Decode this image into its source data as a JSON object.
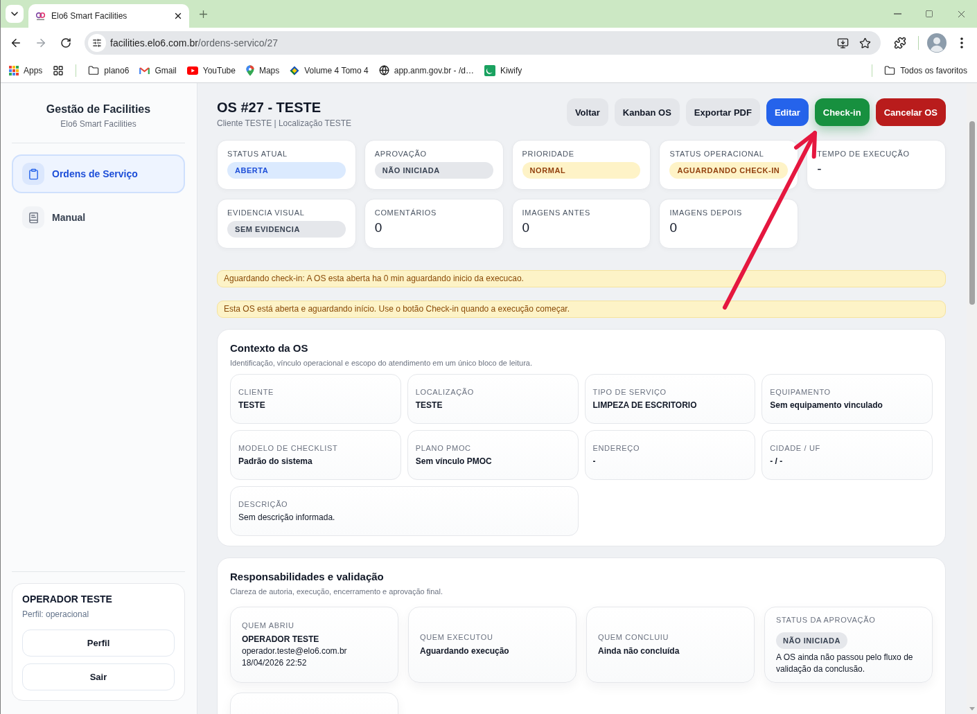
{
  "browser": {
    "tab_title": "Elo6 Smart Facilities",
    "url": {
      "host": "facilities.elo6.com.br",
      "path": "/ordens-servico/27"
    },
    "bookmarks": [
      {
        "kind": "apps",
        "label": "Apps"
      },
      {
        "kind": "groups"
      },
      {
        "kind": "folder",
        "label": "plano6"
      },
      {
        "kind": "mail",
        "label": "Gmail"
      },
      {
        "kind": "video",
        "label": "YouTube"
      },
      {
        "kind": "map",
        "label": "Maps"
      },
      {
        "kind": "site",
        "label": "Volume 4 Tomo 4"
      },
      {
        "kind": "globe",
        "label": "app.anm.gov.br - /d…"
      },
      {
        "kind": "tile",
        "label": "Kiwify"
      }
    ],
    "all_bookmarks": "Todos os favoritos"
  },
  "sidebar": {
    "title": "Gestão de Facilities",
    "subtitle": "Elo6 Smart Facilities",
    "nav": [
      {
        "kind": "orders",
        "label": "Ordens de Serviço",
        "selected": true
      },
      {
        "kind": "manual",
        "label": "Manual",
        "selected": false
      }
    ],
    "user": {
      "name": "OPERADOR TESTE",
      "role": "Perfil: operacional",
      "buttons": [
        "Perfil",
        "Sair"
      ]
    }
  },
  "header": {
    "title": "OS #27 - TESTE",
    "subtitle": "Cliente TESTE | Localização TESTE",
    "actions": [
      {
        "kind": "neutral",
        "label": "Voltar"
      },
      {
        "kind": "neutral",
        "label": "Kanban OS"
      },
      {
        "kind": "neutral",
        "label": "Exportar PDF"
      },
      {
        "kind": "primary",
        "label": "Editar"
      },
      {
        "kind": "success",
        "label": "Check-in"
      },
      {
        "kind": "danger",
        "label": "Cancelar OS"
      }
    ]
  },
  "summary_cards": [
    {
      "kind": "pill",
      "label": "STATUS ATUAL",
      "value": "ABERTA",
      "color": "#dbeafe"
    },
    {
      "kind": "pill",
      "label": "APROVAÇÃO",
      "value": "NÃO INICIADA",
      "color": "#e5e7eb"
    },
    {
      "kind": "pill",
      "label": "PRIORIDADE",
      "value": "NORMAL",
      "color": "#fef3c7"
    },
    {
      "kind": "pill",
      "label": "STATUS OPERACIONAL",
      "value": "AGUARDANDO CHECK-IN",
      "color": "#fef3c7"
    },
    {
      "kind": "count",
      "label": "TEMPO DE EXECUÇÃO",
      "value": "-"
    },
    {
      "kind": "pill",
      "label": "EVIDENCIA VISUAL",
      "value": "SEM EVIDENCIA",
      "color": "#e5e7eb"
    },
    {
      "kind": "count",
      "label": "COMENTÁRIOS",
      "value": "0"
    },
    {
      "kind": "count",
      "label": "IMAGENS ANTES",
      "value": "0"
    },
    {
      "kind": "count",
      "label": "IMAGENS DEPOIS",
      "value": "0"
    }
  ],
  "alerts": [
    "Aguardando check-in: A OS esta aberta ha 0 min aguardando inicio da execucao.",
    "Esta OS está aberta e aguardando início. Use o botão Check-in quando a execução começar."
  ],
  "context": {
    "title": "Contexto da OS",
    "subtitle": "Identificação, vínculo operacional e escopo do atendimento em um único bloco de leitura.",
    "fields": [
      {
        "kind": "field",
        "label": "CLIENTE",
        "value": "TESTE"
      },
      {
        "kind": "field",
        "label": "LOCALIZAÇÃO",
        "value": "TESTE"
      },
      {
        "kind": "field",
        "label": "TIPO DE SERVIÇO",
        "value": "LIMPEZA DE ESCRITORIO"
      },
      {
        "kind": "field",
        "label": "EQUIPAMENTO",
        "value": "Sem equipamento vinculado"
      },
      {
        "kind": "field",
        "label": "MODELO DE CHECKLIST",
        "value": "Padrão do sistema"
      },
      {
        "kind": "field",
        "label": "PLANO PMOC",
        "value": "Sem vínculo PMOC"
      },
      {
        "kind": "field",
        "label": "ENDEREÇO",
        "value": "-"
      },
      {
        "kind": "field",
        "label": "CIDADE / UF",
        "value": "- / -"
      },
      {
        "kind": "description",
        "label": "DESCRIÇÃO",
        "value": "Sem descrição informada."
      }
    ]
  },
  "responsibilities": {
    "title": "Responsabilidades e validação",
    "subtitle": "Clareza de autoria, execução, encerramento e aprovação final.",
    "cards": [
      {
        "kind": "person",
        "label": "QUEM ABRIU",
        "name": "OPERADOR TESTE",
        "email": "operador.teste@elo6.com.br",
        "date": "18/04/2026 22:52"
      },
      {
        "kind": "text",
        "label": "QUEM EXECUTOU",
        "value": "Aguardando execução"
      },
      {
        "kind": "text",
        "label": "QUEM CONCLUIU",
        "value": "Ainda não concluída"
      },
      {
        "kind": "status",
        "label": "STATUS DA APROVAÇÃO",
        "pill": "NÃO INICIADA",
        "color": "#e5e7eb",
        "note": "A OS ainda não passou pelo fluxo de validação da conclusão."
      }
    ]
  }
}
